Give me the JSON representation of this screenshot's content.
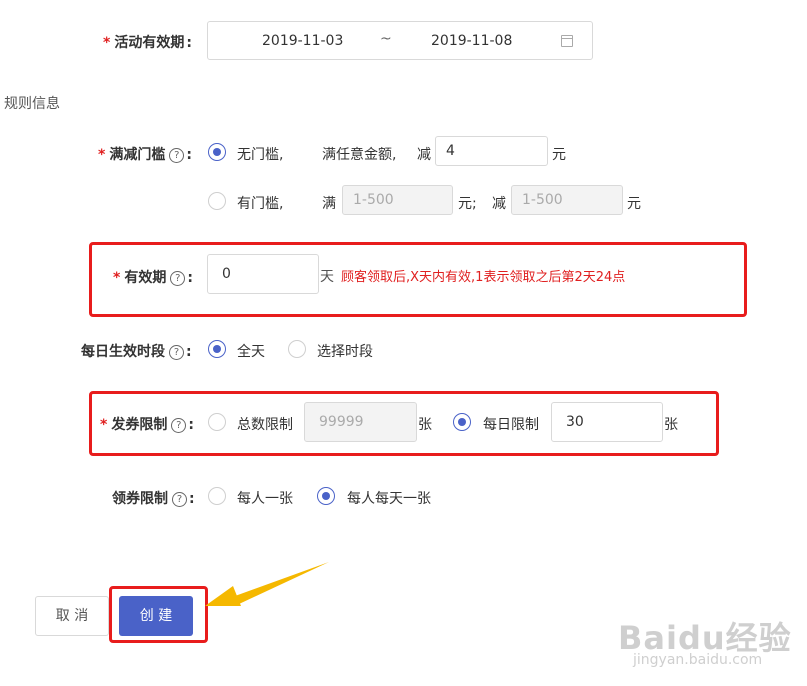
{
  "activity": {
    "required_mark": "*",
    "label": "活动有效期",
    "colon": ":",
    "start_date": "2019-11-03",
    "separator": "~",
    "end_date": "2019-11-08",
    "icon": "calendar-icon"
  },
  "section_title": "规则信息",
  "threshold": {
    "required_mark": "*",
    "label": "满减门槛",
    "help": "?",
    "colon": ":",
    "option1": {
      "label": "无门槛,",
      "text_full": "满任意金额,",
      "text_minus": "减",
      "value": "4",
      "unit": "元",
      "selected": true
    },
    "option2": {
      "label": "有门槛,",
      "text_full": "满",
      "placeholder1": "1-500",
      "unit1": "元;",
      "text_minus": "减",
      "placeholder2": "1-500",
      "unit2": "元",
      "selected": false
    }
  },
  "validity": {
    "required_mark": "*",
    "label": "有效期",
    "help": "?",
    "colon": ":",
    "value": "0",
    "unit": "天",
    "hint": "顾客领取后,X天内有效,1表示领取之后第2天24点"
  },
  "daily_period": {
    "label": "每日生效时段",
    "help": "?",
    "colon": ":",
    "option1": "全天",
    "option2": "选择时段",
    "selected": "全天"
  },
  "issue_limit": {
    "required_mark": "*",
    "label": "发券限制",
    "help": "?",
    "colon": ":",
    "option1": "总数限制",
    "option1_placeholder": "99999",
    "option1_unit": "张",
    "option2": "每日限制",
    "option2_value": "30",
    "option2_unit": "张",
    "selected": "每日限制"
  },
  "claim_limit": {
    "label": "领券限制",
    "help": "?",
    "colon": ":",
    "option1": "每人一张",
    "option2": "每人每天一张",
    "selected": "每人每天一张"
  },
  "buttons": {
    "cancel": "取 消",
    "create": "创 建"
  },
  "colors": {
    "primary": "#4a62c8",
    "highlight_red": "#e81c1c",
    "arrow": "#f5b800"
  },
  "watermark": {
    "brand": "Baidu经验",
    "url": "jingyan.baidu.com"
  }
}
